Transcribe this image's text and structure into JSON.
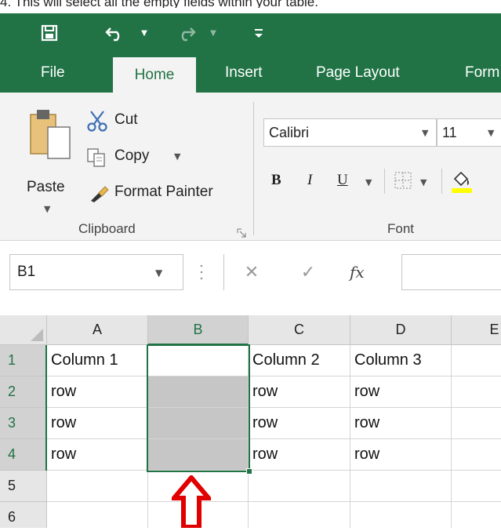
{
  "caption": "4. This will select all the empty fields within your table.",
  "qat": {
    "save_icon": "save-icon",
    "undo_icon": "undo-icon",
    "redo_icon": "redo-icon",
    "customize_icon": "customize-qat-icon"
  },
  "tabs": [
    "File",
    "Home",
    "Insert",
    "Page Layout",
    "Form"
  ],
  "active_tab": "Home",
  "ribbon": {
    "paste": "Paste",
    "cut": "Cut",
    "copy": "Copy",
    "format_painter": "Format Painter",
    "clipboard_label": "Clipboard",
    "font_name": "Calibri",
    "font_size": "11",
    "bold": "B",
    "italic": "I",
    "underline": "U",
    "font_label": "Font"
  },
  "formula_bar": {
    "name_box": "B1",
    "cancel": "✕",
    "enter": "✓",
    "fx": "fx",
    "value": ""
  },
  "sheet": {
    "columns": [
      "A",
      "B",
      "C",
      "D",
      "E"
    ],
    "rows": [
      "1",
      "2",
      "3",
      "4",
      "5",
      "6"
    ],
    "cells": [
      [
        "Column 1",
        "",
        "Column 2",
        "Column 3",
        ""
      ],
      [
        "row",
        "",
        "row",
        "row",
        ""
      ],
      [
        "row",
        "",
        "row",
        "row",
        ""
      ],
      [
        "row",
        "",
        "row",
        "row",
        ""
      ],
      [
        "",
        "",
        "",
        "",
        ""
      ],
      [
        "",
        "",
        "",
        "",
        ""
      ]
    ],
    "selected_column": "B",
    "annotation_color": "#e00000"
  },
  "colors": {
    "excel_green": "#217346",
    "selection_gray": "#c6c6c6"
  }
}
